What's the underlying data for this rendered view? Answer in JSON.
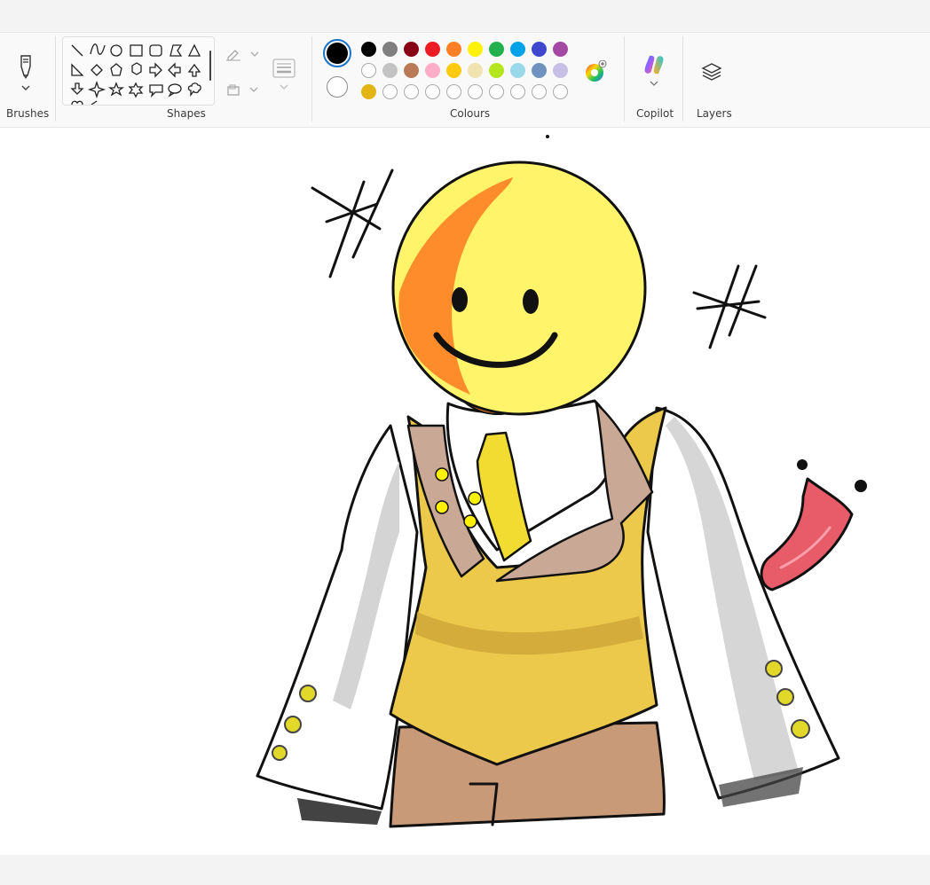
{
  "ribbon": {
    "groups": {
      "brushes": "Brushes",
      "shapes": "Shapes",
      "colours": "Colours",
      "copilot": "Copilot",
      "layers": "Layers"
    },
    "shapes": [
      "line-icon",
      "curve-icon",
      "oval-icon",
      "rectangle-icon",
      "rounded-rectangle-icon",
      "polygon-icon",
      "triangle-icon",
      "right-triangle-icon",
      "diamond-icon",
      "pentagon-icon",
      "hexagon-icon",
      "arrow-right-icon",
      "arrow-left-icon",
      "arrow-up-icon",
      "arrow-down-icon",
      "four-point-star-icon",
      "five-point-star-icon",
      "six-point-star-icon",
      "rect-callout-icon",
      "oval-callout-icon",
      "cloud-callout-icon"
    ],
    "colour1": "#000000",
    "colour2": "#ffffff",
    "palette_row1": [
      "#000000",
      "#7f7f7f",
      "#880015",
      "#ed1c24",
      "#ff7f27",
      "#fff200",
      "#22b14c",
      "#00a2e8",
      "#3f48cc",
      "#a349a4"
    ],
    "palette_row2": [
      "#ffffff",
      "#c3c3c3",
      "#b97a57",
      "#ffaec9",
      "#ffc90e",
      "#efe4b0",
      "#b5e61d",
      "#99d9ea",
      "#7092be",
      "#c8bfe7"
    ],
    "palette_row3": [
      "#e2b514"
    ]
  },
  "canvas": {
    "colors": {
      "face": "#fff46a",
      "face_shade": "#ff8c2a",
      "vest": "#ecc94a",
      "lapel": "#c9a896",
      "pants": "#c99a78",
      "tongue": "#e85c6a",
      "sleeve_shadow": "#cfcfcf",
      "button": "#f0e020",
      "ink": "#111111"
    }
  }
}
